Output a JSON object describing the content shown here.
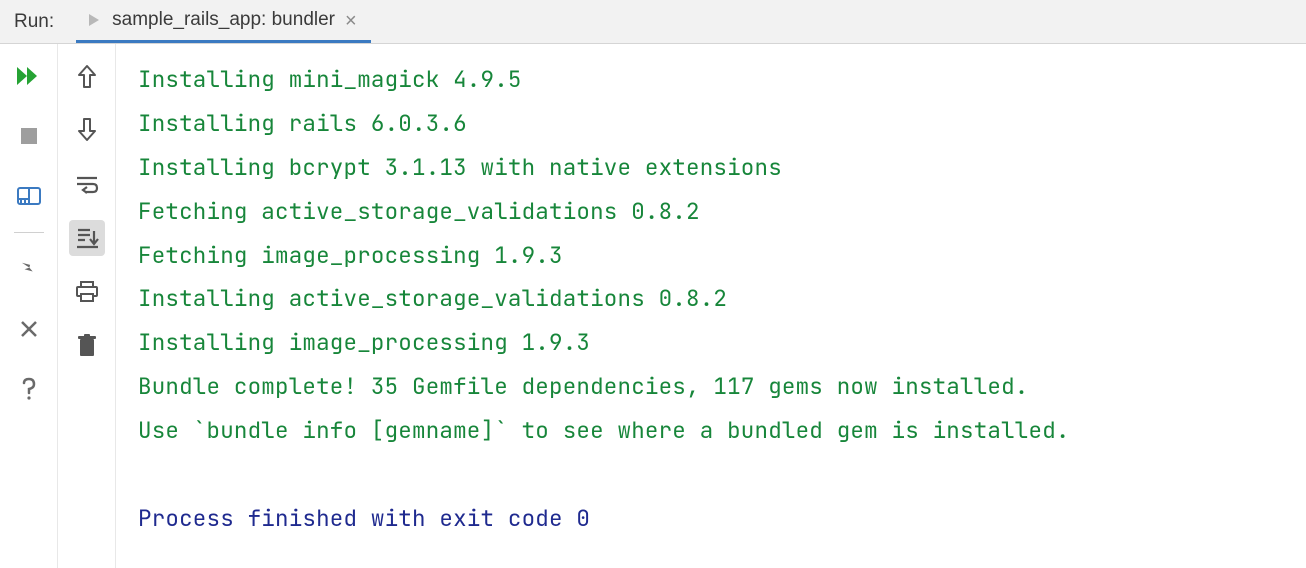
{
  "titlebar": {
    "run_label": "Run:",
    "tab_title": "sample_rails_app: bundler"
  },
  "console": {
    "lines": [
      {
        "cls": "green",
        "text": "Installing mini_magick 4.9.5"
      },
      {
        "cls": "green",
        "text": "Installing rails 6.0.3.6"
      },
      {
        "cls": "green",
        "text": "Installing bcrypt 3.1.13 with native extensions"
      },
      {
        "cls": "green",
        "text": "Fetching active_storage_validations 0.8.2"
      },
      {
        "cls": "green",
        "text": "Fetching image_processing 1.9.3"
      },
      {
        "cls": "green",
        "text": "Installing active_storage_validations 0.8.2"
      },
      {
        "cls": "green",
        "text": "Installing image_processing 1.9.3"
      },
      {
        "cls": "green",
        "text": "Bundle complete! 35 Gemfile dependencies, 117 gems now installed."
      },
      {
        "cls": "green",
        "text": "Use `bundle info [gemname]` to see where a bundled gem is installed."
      },
      {
        "cls": "",
        "text": ""
      },
      {
        "cls": "navy",
        "text": "Process finished with exit code 0"
      }
    ]
  }
}
